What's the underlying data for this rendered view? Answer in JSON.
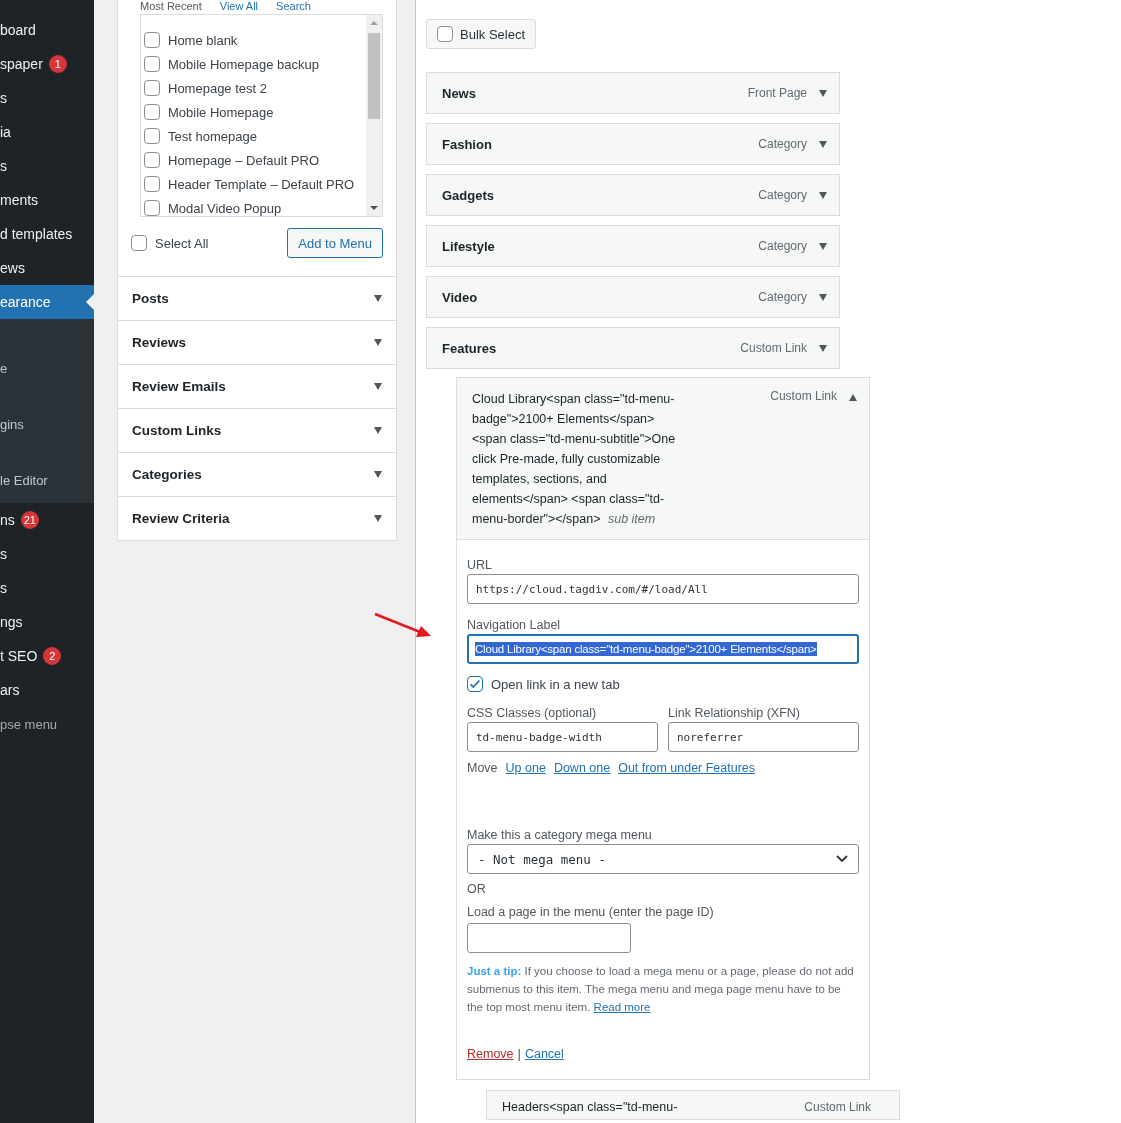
{
  "sidebar": {
    "items": [
      {
        "label": "board",
        "kind": "main",
        "selected": false
      },
      {
        "label": "spaper",
        "kind": "main",
        "selected": false,
        "badge": "1"
      },
      {
        "label": "s",
        "kind": "main",
        "selected": false
      },
      {
        "label": "ia",
        "kind": "main",
        "selected": false
      },
      {
        "label": "s",
        "kind": "main",
        "selected": false
      },
      {
        "label": "ments",
        "kind": "main",
        "selected": false
      },
      {
        "label": "d templates",
        "kind": "main",
        "selected": false
      },
      {
        "label": "ews",
        "kind": "main",
        "selected": false
      },
      {
        "label": "earance",
        "kind": "main",
        "selected": true,
        "children": [
          {
            "label": "e"
          },
          {
            "label": "gins"
          },
          {
            "label": "le Editor"
          }
        ]
      },
      {
        "label": "ns",
        "kind": "main",
        "selected": false,
        "badge": "21"
      },
      {
        "label": "s",
        "kind": "main",
        "selected": false
      },
      {
        "label": "s",
        "kind": "main",
        "selected": false
      },
      {
        "label": "ngs",
        "kind": "main",
        "selected": false
      },
      {
        "label": "t SEO",
        "kind": "main",
        "selected": false,
        "badge": "2"
      },
      {
        "label": "ars",
        "kind": "main",
        "selected": false
      },
      {
        "label": "pse menu",
        "kind": "collapse",
        "selected": false
      }
    ]
  },
  "add_items": {
    "tabs": [
      {
        "label": "Most Recent",
        "selected": true
      },
      {
        "label": "View All",
        "selected": false
      },
      {
        "label": "Search",
        "selected": false
      }
    ],
    "pages": [
      {
        "label": "Home blank",
        "checked": false
      },
      {
        "label": "Mobile Homepage backup",
        "checked": false
      },
      {
        "label": "Homepage test 2",
        "checked": false
      },
      {
        "label": "Mobile Homepage",
        "checked": false
      },
      {
        "label": "Test homepage",
        "checked": false
      },
      {
        "label": "Homepage – Default PRO",
        "checked": false
      },
      {
        "label": "Header Template – Default PRO",
        "checked": false
      },
      {
        "label": "Modal Video Popup",
        "checked": false
      }
    ],
    "select_all": {
      "label": "Select All",
      "checked": false
    },
    "add_button": "Add to Menu",
    "sections": [
      {
        "title": "Posts"
      },
      {
        "title": "Reviews"
      },
      {
        "title": "Review Emails"
      },
      {
        "title": "Custom Links"
      },
      {
        "title": "Categories"
      },
      {
        "title": "Review Criteria"
      }
    ]
  },
  "menu": {
    "bulk_select": {
      "label": "Bulk Select",
      "checked": false
    },
    "items": [
      {
        "title": "News",
        "type": "Front Page"
      },
      {
        "title": "Fashion",
        "type": "Category"
      },
      {
        "title": "Gadgets",
        "type": "Category"
      },
      {
        "title": "Lifestyle",
        "type": "Category"
      },
      {
        "title": "Video",
        "type": "Category"
      },
      {
        "title": "Features",
        "type": "Custom Link"
      }
    ],
    "open_item": {
      "title": "Cloud Library<span class=\"td-menu-badge\">2100+ Elements</span><span class=\"td-menu-subtitle\">One click Pre-made, fully customizable templates, sections, and elements</span> <span class=\"td-menu-border\"></span>",
      "note": "sub item",
      "type": "Custom Link",
      "url_label": "URL",
      "url": "https://cloud.tagdiv.com/#/load/All",
      "nav_label": "Navigation Label",
      "nav_value": "Cloud Library<span class=\"td-menu-badge\">2100+ Elements</span>",
      "new_tab": {
        "label": "Open link in a new tab",
        "checked": true
      },
      "css_label": "CSS Classes (optional)",
      "css_value": "td-menu-badge-width",
      "xfn_label": "Link Relationship (XFN)",
      "xfn_value": "noreferrer",
      "move_label": "Move",
      "move_links": [
        "Up one",
        "Down one",
        "Out from under Features"
      ],
      "mega_label": "Make this a category mega menu",
      "mega_value": "- Not mega menu -",
      "or_text": "OR",
      "page_label": "Load a page in the menu (enter the page ID)",
      "tip": "**Just a tip:** If you choose to load a mega menu or a page, please do not add submenus to this item. The mega menu and mega page menu have to be the top most menu item.",
      "tip_link": "Read more",
      "remove": "Remove",
      "separator": "|",
      "cancel": "Cancel"
    },
    "next_item": {
      "title": "Headers<span class=\"td-menu-",
      "type": "Custom Link"
    }
  }
}
